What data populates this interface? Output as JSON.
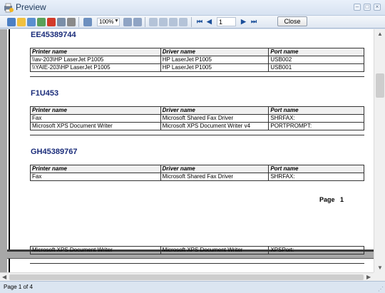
{
  "window": {
    "title": "Preview"
  },
  "toolbar": {
    "zoom": "100%",
    "page_number": "1",
    "close_label": "Close",
    "first_glyph": "⏮",
    "prev_glyph": "◀",
    "next_glyph": "▶",
    "last_glyph": "⏭"
  },
  "report": {
    "headers": {
      "printer": "Printer name",
      "driver": "Driver name",
      "port": "Port name"
    },
    "groups": [
      {
        "name": "EE45389744",
        "rows": [
          {
            "printer": "\\\\av-203\\HP LaserJet P1005",
            "driver": "HP LaserJet P1005",
            "port": "USB002"
          },
          {
            "printer": "\\\\YAIE-203\\HP LaserJet P1005",
            "driver": "HP LaserJet P1005",
            "port": "USB001"
          }
        ]
      },
      {
        "name": "F1U453",
        "rows": [
          {
            "printer": "Fax",
            "driver": "Microsoft Shared Fax Driver",
            "port": "SHRFAX:"
          },
          {
            "printer": "Microsoft XPS Document Writer",
            "driver": "Microsoft XPS Document Writer v4",
            "port": "PORTPROMPT:"
          }
        ]
      },
      {
        "name": "GH45389767",
        "rows": [
          {
            "printer": "Fax",
            "driver": "Microsoft Shared Fax Driver",
            "port": "SHRFAX:"
          }
        ]
      }
    ],
    "page_footer_label": "Page",
    "page_footer_number": "1",
    "next_page_row": {
      "printer": "Microsoft XPS Document Writer",
      "driver": "Microsoft XPS Document Writer",
      "port": "XPSPort:"
    }
  },
  "status": {
    "text": "Page 1 of 4"
  }
}
